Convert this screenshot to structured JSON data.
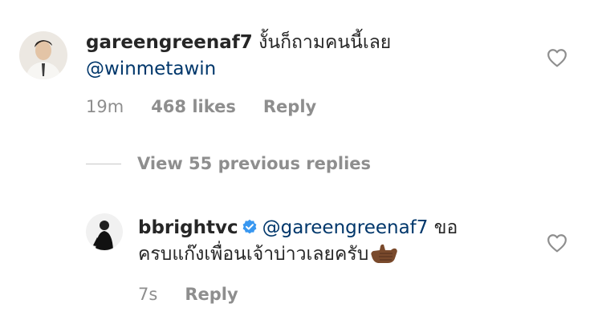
{
  "comment": {
    "username": "gareengreenaf7",
    "text": "งั้นก็ถามคนนี้เลย",
    "mention": "@winmetawin",
    "time": "19m",
    "likes": "468 likes",
    "reply_label": "Reply"
  },
  "view_replies": {
    "label": "View 55 previous replies"
  },
  "reply": {
    "username": "bbrightvc",
    "mention": "@gareengreenaf7",
    "text_line1": "ขอ",
    "text_line2": "ครบแก๊งเพื่อนเจ้าบ่าวเลยครับ",
    "emoji_icon": "call-me-hand-icon",
    "time": "7s",
    "reply_label": "Reply"
  },
  "colors": {
    "mention": "#00376b",
    "meta": "#8e8e8e",
    "verified": "#3897f0"
  }
}
